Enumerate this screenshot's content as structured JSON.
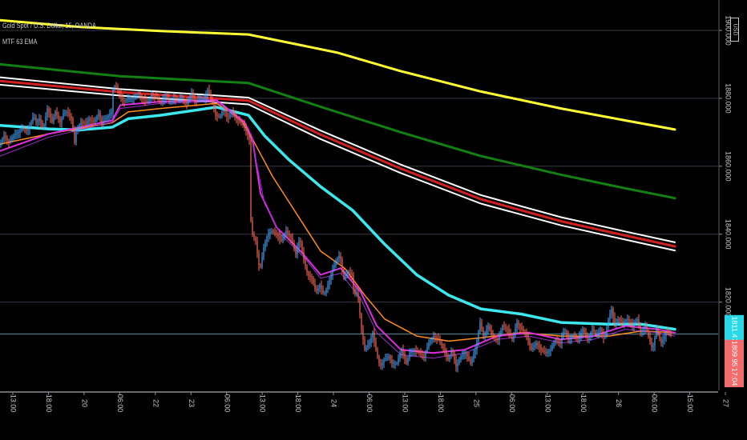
{
  "symbol_title": "Gold Spot / U.S. Dollar, 15, OANDA",
  "indicator_name": "MTF 63 EMA",
  "currency_button": "USD",
  "colors": {
    "background": "#000000",
    "grid": "#363a45",
    "axis_text": "#c8c8c8",
    "up_candle": "#4aa8ff",
    "down_candle": "#ff6a5a",
    "ema_yellow": "#ffff33",
    "ema_green": "#128012",
    "ema_red": "#d22020",
    "ema_white": "#ffffff",
    "ema_cyan": "#3ce8ee",
    "ema_orange": "#ff8c1a",
    "ema_magenta": "#dd2ee0",
    "ema_purple": "#9b30c8",
    "price_line": "#4a6b76",
    "tag_cyan": "#28d8e6",
    "tag_red": "#f26a6a"
  },
  "chart_data": {
    "type": "line",
    "chart_style": "candlestick with EMA overlays",
    "ylim": [
      1794,
      1908
    ],
    "y_ticks": [
      {
        "value": 1900,
        "label": "1900.000"
      },
      {
        "value": 1880,
        "label": "1880.000"
      },
      {
        "value": 1860,
        "label": "1860.000"
      },
      {
        "value": 1840,
        "label": "1840.000"
      },
      {
        "value": 1820,
        "label": "1820.000"
      }
    ],
    "x_ticks": [
      "13:00",
      "18:00",
      "20",
      "06:00",
      "22",
      "23",
      "06:00",
      "13:00",
      "18:00",
      "24",
      "06:00",
      "13:00",
      "18:00",
      "25",
      "06:00",
      "13:00",
      "18:00",
      "26",
      "06:00",
      "15:00",
      "27"
    ],
    "price_tags": [
      {
        "label": "1811.474",
        "value": 1811.474,
        "color": "tag_cyan"
      },
      {
        "label": "1809.956",
        "value": 1804.2,
        "color": "tag_red"
      },
      {
        "label": "17:04",
        "value": 1798.0,
        "color": "tag_red"
      }
    ],
    "current_price": 1810.6,
    "candle_path": [
      [
        0,
        1866.0
      ],
      [
        6,
        1869.0
      ],
      [
        12,
        1867.0
      ],
      [
        18,
        1869.0
      ],
      [
        24,
        1870.0
      ],
      [
        29,
        1871.3
      ],
      [
        35,
        1870.3
      ],
      [
        40,
        1873.0
      ],
      [
        43,
        1875.0
      ],
      [
        46,
        1873.0
      ],
      [
        50,
        1874.0
      ],
      [
        55,
        1871.0
      ],
      [
        60,
        1877.0
      ],
      [
        66,
        1873.0
      ],
      [
        70,
        1876.0
      ],
      [
        76,
        1873.0
      ],
      [
        80,
        1875.5
      ],
      [
        85,
        1876.0
      ],
      [
        90,
        1874.0
      ],
      [
        94,
        1867.0
      ],
      [
        96,
        1870.5
      ],
      [
        102,
        1873.0
      ],
      [
        108,
        1872.5
      ],
      [
        112,
        1874.0
      ],
      [
        118,
        1873.0
      ],
      [
        124,
        1875.5
      ],
      [
        128,
        1873.0
      ],
      [
        135,
        1874.5
      ],
      [
        140,
        1876.0
      ],
      [
        141,
        1882.0
      ],
      [
        145,
        1884.0
      ],
      [
        150,
        1881.0
      ],
      [
        155,
        1879.0
      ],
      [
        162,
        1880.0
      ],
      [
        168,
        1880.0
      ],
      [
        173,
        1881.0
      ],
      [
        178,
        1880.0
      ],
      [
        185,
        1879.0
      ],
      [
        190,
        1881.0
      ],
      [
        197,
        1880.0
      ],
      [
        202,
        1879.0
      ],
      [
        208,
        1881.0
      ],
      [
        212,
        1879.0
      ],
      [
        218,
        1880.0
      ],
      [
        222,
        1879.5
      ],
      [
        228,
        1880.0
      ],
      [
        234,
        1878.5
      ],
      [
        240,
        1881.5
      ],
      [
        245,
        1879.0
      ],
      [
        250,
        1880.0
      ],
      [
        256,
        1880.0
      ],
      [
        260,
        1882.5
      ],
      [
        266,
        1879.0
      ],
      [
        270,
        1875.0
      ],
      [
        275,
        1874.5
      ],
      [
        280,
        1877.0
      ],
      [
        285,
        1874.0
      ],
      [
        290,
        1876.0
      ],
      [
        296,
        1874.0
      ],
      [
        300,
        1873.0
      ],
      [
        305,
        1872.0
      ],
      [
        312,
        1868.0
      ],
      [
        314,
        1844.0
      ],
      [
        316,
        1840.0
      ],
      [
        320,
        1838.0
      ],
      [
        325,
        1829.0
      ],
      [
        330,
        1836.0
      ],
      [
        335,
        1840.0
      ],
      [
        340,
        1841.0
      ],
      [
        346,
        1840.0
      ],
      [
        352,
        1838.0
      ],
      [
        358,
        1841.0
      ],
      [
        364,
        1839.0
      ],
      [
        370,
        1834.0
      ],
      [
        375,
        1839.0
      ],
      [
        380,
        1832.0
      ],
      [
        385,
        1828.0
      ],
      [
        390,
        1827.0
      ],
      [
        395,
        1823.0
      ],
      [
        400,
        1825.0
      ],
      [
        405,
        1822.0
      ],
      [
        410,
        1825.0
      ],
      [
        415,
        1829.0
      ],
      [
        420,
        1832.0
      ],
      [
        425,
        1834.0
      ],
      [
        430,
        1827.0
      ],
      [
        435,
        1829.0
      ],
      [
        440,
        1828.0
      ],
      [
        443,
        1822.0
      ],
      [
        447,
        1823.0
      ],
      [
        452,
        1812.0
      ],
      [
        456,
        1806.0
      ],
      [
        462,
        1808.0
      ],
      [
        466,
        1811.0
      ],
      [
        470,
        1806.0
      ],
      [
        475,
        1801.0
      ],
      [
        480,
        1803.0
      ],
      [
        486,
        1804.0
      ],
      [
        490,
        1802.0
      ],
      [
        496,
        1802.0
      ],
      [
        502,
        1806.0
      ],
      [
        508,
        1802.0
      ],
      [
        512,
        1805.0
      ],
      [
        518,
        1806.0
      ],
      [
        524,
        1805.0
      ],
      [
        530,
        1804.0
      ],
      [
        536,
        1808.0
      ],
      [
        542,
        1810.0
      ],
      [
        548,
        1809.0
      ],
      [
        555,
        1806.0
      ],
      [
        560,
        1803.0
      ],
      [
        565,
        1806.0
      ],
      [
        570,
        1801.0
      ],
      [
        576,
        1804.0
      ],
      [
        582,
        1805.0
      ],
      [
        588,
        1802.0
      ],
      [
        594,
        1806.0
      ],
      [
        600,
        1814.0
      ],
      [
        604,
        1810.0
      ],
      [
        610,
        1813.0
      ],
      [
        615,
        1810.0
      ],
      [
        622,
        1809.0
      ],
      [
        628,
        1813.0
      ],
      [
        634,
        1812.0
      ],
      [
        640,
        1809.0
      ],
      [
        646,
        1814.0
      ],
      [
        652,
        1812.0
      ],
      [
        658,
        1810.0
      ],
      [
        664,
        1806.0
      ],
      [
        670,
        1808.0
      ],
      [
        676,
        1806.0
      ],
      [
        682,
        1805.0
      ],
      [
        688,
        1806.0
      ],
      [
        694,
        1809.0
      ],
      [
        700,
        1808.0
      ],
      [
        705,
        1812.0
      ],
      [
        710,
        1809.0
      ],
      [
        716,
        1810.0
      ],
      [
        722,
        1809.0
      ],
      [
        728,
        1812.0
      ],
      [
        734,
        1809.0
      ],
      [
        740,
        1812.0
      ],
      [
        745,
        1810.0
      ],
      [
        750,
        1812.0
      ],
      [
        755,
        1809.0
      ],
      [
        760,
        1815.0
      ],
      [
        764,
        1818.0
      ],
      [
        768,
        1813.0
      ],
      [
        772,
        1815.0
      ],
      [
        778,
        1814.0
      ],
      [
        784,
        1815.0
      ],
      [
        790,
        1813.0
      ],
      [
        796,
        1815.0
      ],
      [
        800,
        1811.0
      ],
      [
        806,
        1813.0
      ],
      [
        810,
        1810.0
      ],
      [
        815,
        1806.0
      ],
      [
        820,
        1812.0
      ],
      [
        826,
        1808.0
      ],
      [
        832,
        1811.0
      ],
      [
        838,
        1810.6
      ]
    ],
    "ema_series": [
      {
        "color": "ema_yellow",
        "width": 3,
        "points": [
          [
            0,
            1903.0
          ],
          [
            100,
            1901.0
          ],
          [
            200,
            1899.8
          ],
          [
            310,
            1898.8
          ],
          [
            420,
            1893.5
          ],
          [
            500,
            1888.0
          ],
          [
            600,
            1882.0
          ],
          [
            700,
            1877.0
          ],
          [
            780,
            1873.5
          ],
          [
            842,
            1870.8
          ]
        ]
      },
      {
        "color": "ema_green",
        "width": 3,
        "points": [
          [
            0,
            1890.0
          ],
          [
            150,
            1886.5
          ],
          [
            310,
            1884.5
          ],
          [
            400,
            1877.5
          ],
          [
            500,
            1870.0
          ],
          [
            600,
            1863.0
          ],
          [
            700,
            1857.5
          ],
          [
            780,
            1853.5
          ],
          [
            842,
            1850.6
          ]
        ]
      },
      {
        "color": "ema_white",
        "width": 2,
        "points": [
          [
            0,
            1886.2
          ],
          [
            150,
            1882.7
          ],
          [
            310,
            1880.2
          ],
          [
            400,
            1870.5
          ],
          [
            500,
            1860.5
          ],
          [
            600,
            1851.5
          ],
          [
            700,
            1845.0
          ],
          [
            780,
            1840.8
          ],
          [
            842,
            1837.6
          ]
        ]
      },
      {
        "color": "ema_red",
        "width": 3,
        "points": [
          [
            0,
            1885.1
          ],
          [
            150,
            1881.8
          ],
          [
            310,
            1879.3
          ],
          [
            400,
            1869.3
          ],
          [
            500,
            1859.3
          ],
          [
            600,
            1850.3
          ],
          [
            700,
            1843.8
          ],
          [
            780,
            1839.6
          ],
          [
            842,
            1836.4
          ]
        ]
      },
      {
        "color": "ema_white",
        "width": 2,
        "points": [
          [
            0,
            1884.0
          ],
          [
            150,
            1880.8
          ],
          [
            310,
            1878.2
          ],
          [
            400,
            1868.0
          ],
          [
            500,
            1858.0
          ],
          [
            600,
            1849.0
          ],
          [
            700,
            1842.6
          ],
          [
            780,
            1838.4
          ],
          [
            842,
            1835.2
          ]
        ]
      },
      {
        "color": "ema_cyan",
        "width": 3.5,
        "points": [
          [
            0,
            1872.0
          ],
          [
            60,
            1871.0
          ],
          [
            100,
            1870.7
          ],
          [
            140,
            1871.5
          ],
          [
            160,
            1874.0
          ],
          [
            200,
            1875.0
          ],
          [
            270,
            1877.4
          ],
          [
            310,
            1875.0
          ],
          [
            330,
            1869.0
          ],
          [
            360,
            1862.0
          ],
          [
            400,
            1854.0
          ],
          [
            440,
            1847.0
          ],
          [
            480,
            1837.0
          ],
          [
            520,
            1828.0
          ],
          [
            560,
            1822.0
          ],
          [
            600,
            1818.0
          ],
          [
            650,
            1816.5
          ],
          [
            700,
            1814.0
          ],
          [
            760,
            1813.5
          ],
          [
            800,
            1813.5
          ],
          [
            842,
            1812.0
          ]
        ]
      },
      {
        "color": "ema_orange",
        "width": 1.5,
        "points": [
          [
            0,
            1866.5
          ],
          [
            60,
            1869.5
          ],
          [
            140,
            1872.8
          ],
          [
            160,
            1876.0
          ],
          [
            200,
            1877.0
          ],
          [
            270,
            1878.5
          ],
          [
            300,
            1874.0
          ],
          [
            315,
            1868.0
          ],
          [
            340,
            1857.0
          ],
          [
            370,
            1846.0
          ],
          [
            400,
            1835.0
          ],
          [
            430,
            1830.0
          ],
          [
            455,
            1822.0
          ],
          [
            480,
            1815.0
          ],
          [
            520,
            1810.0
          ],
          [
            560,
            1808.5
          ],
          [
            600,
            1809.5
          ],
          [
            650,
            1811.0
          ],
          [
            700,
            1810.0
          ],
          [
            760,
            1810.0
          ],
          [
            800,
            1811.5
          ],
          [
            842,
            1811.0
          ]
        ]
      },
      {
        "color": "ema_magenta",
        "width": 2,
        "points": [
          [
            0,
            1864.5
          ],
          [
            60,
            1869.5
          ],
          [
            140,
            1873.5
          ],
          [
            150,
            1878.0
          ],
          [
            200,
            1879.0
          ],
          [
            270,
            1879.5
          ],
          [
            305,
            1873.0
          ],
          [
            315,
            1868.0
          ],
          [
            325,
            1852.0
          ],
          [
            345,
            1842.0
          ],
          [
            375,
            1835.0
          ],
          [
            400,
            1828.0
          ],
          [
            425,
            1830.0
          ],
          [
            450,
            1823.0
          ],
          [
            470,
            1813.0
          ],
          [
            500,
            1806.0
          ],
          [
            540,
            1805.0
          ],
          [
            580,
            1806.0
          ],
          [
            620,
            1810.0
          ],
          [
            660,
            1811.0
          ],
          [
            700,
            1809.0
          ],
          [
            740,
            1810.0
          ],
          [
            780,
            1813.0
          ],
          [
            820,
            1812.0
          ],
          [
            842,
            1811.0
          ]
        ]
      },
      {
        "color": "ema_purple",
        "width": 1,
        "points": [
          [
            0,
            1863.0
          ],
          [
            60,
            1868.5
          ],
          [
            140,
            1873.0
          ],
          [
            150,
            1877.0
          ],
          [
            200,
            1878.5
          ],
          [
            270,
            1879.0
          ],
          [
            305,
            1872.5
          ],
          [
            315,
            1867.0
          ],
          [
            330,
            1849.0
          ],
          [
            350,
            1840.0
          ],
          [
            380,
            1833.0
          ],
          [
            400,
            1827.0
          ],
          [
            425,
            1828.5
          ],
          [
            450,
            1821.0
          ],
          [
            470,
            1811.0
          ],
          [
            500,
            1804.5
          ],
          [
            540,
            1803.5
          ],
          [
            580,
            1805.0
          ],
          [
            620,
            1809.0
          ],
          [
            660,
            1810.0
          ],
          [
            700,
            1808.0
          ],
          [
            740,
            1809.0
          ],
          [
            780,
            1812.0
          ],
          [
            820,
            1811.0
          ],
          [
            842,
            1810.0
          ]
        ]
      }
    ]
  }
}
